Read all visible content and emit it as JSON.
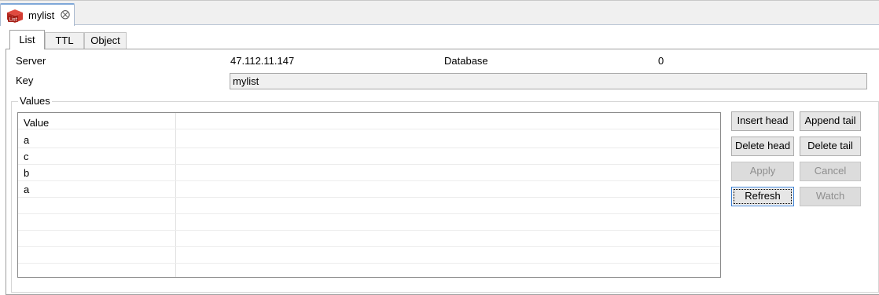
{
  "editor_tab": {
    "label": "mylist",
    "icon": "redis-list-icon",
    "icon_text": "List"
  },
  "inner_tabs": [
    {
      "label": "List",
      "active": true
    },
    {
      "label": "TTL",
      "active": false
    },
    {
      "label": "Object",
      "active": false
    }
  ],
  "info": {
    "server_label": "Server",
    "server_value": "47.112.11.147",
    "database_label": "Database",
    "database_value": "0",
    "key_label": "Key",
    "key_value": "mylist"
  },
  "values": {
    "group_title": "Values",
    "column_header": "Value",
    "rows": [
      "a",
      "c",
      "b",
      "a",
      "",
      "",
      "",
      ""
    ]
  },
  "buttons": {
    "insert_head": "Insert head",
    "append_tail": "Append tail",
    "delete_head": "Delete head",
    "delete_tail": "Delete tail",
    "apply": "Apply",
    "cancel": "Cancel",
    "refresh": "Refresh",
    "watch": "Watch"
  },
  "colors": {
    "accent": "#3c7fd1",
    "icon_red": "#c9302c"
  }
}
